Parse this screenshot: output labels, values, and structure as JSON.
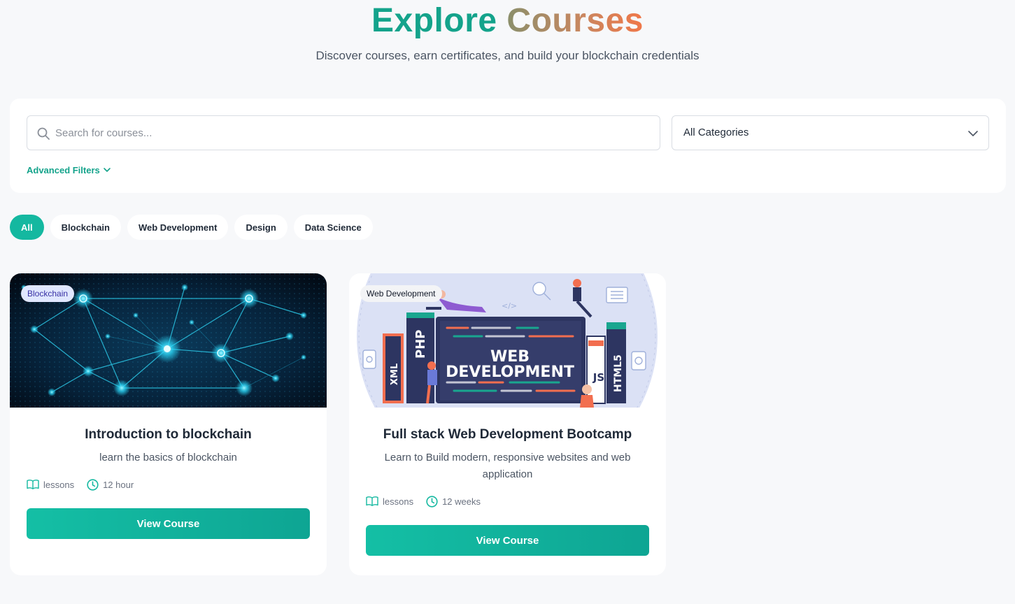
{
  "hero": {
    "title_part1": "Explore",
    "title_part2": "Courses",
    "subtitle": "Discover courses, earn certificates, and build your blockchain credentials"
  },
  "search": {
    "placeholder": "Search for courses...",
    "value": "",
    "category_selected": "All Categories",
    "category_options": [
      "All Categories"
    ],
    "advanced_filters_label": "Advanced Filters"
  },
  "filters": {
    "pills": [
      {
        "label": "All",
        "active": true
      },
      {
        "label": "Blockchain",
        "active": false
      },
      {
        "label": "Web Development",
        "active": false
      },
      {
        "label": "Design",
        "active": false
      },
      {
        "label": "Data Science",
        "active": false
      }
    ]
  },
  "courses": [
    {
      "badge": "Blockchain",
      "title": "Introduction to blockchain",
      "description": "learn the basics of blockchain",
      "lessons_label": "lessons",
      "duration": "12 hour",
      "button_label": "View Course"
    },
    {
      "badge": "Web Development",
      "title": "Full stack Web Development Bootcamp",
      "description": "Learn to Build modern, responsive websites and web application",
      "lessons_label": "lessons",
      "duration": "12 weeks",
      "button_label": "View Course",
      "image_text": {
        "line1": "WEB",
        "line2": "DEVELOPMENT",
        "book_php": "PHP",
        "book_xml": "XML",
        "book_html5": "HTML5",
        "book_js": "JS"
      }
    }
  ],
  "colors": {
    "accent": "#14b8a0",
    "accent_dark": "#0ea593",
    "title_green": "#14a38b",
    "title_orange": "#f07748",
    "background": "#f7f8fa",
    "blockchain_badge_bg": "#e0e7ff",
    "blockchain_badge_text": "#3730a3",
    "webdev_badge_bg": "#f3f4f6"
  },
  "icons": {
    "search": "search-icon",
    "chevron": "chevron-down-icon",
    "lessons": "book-open-icon",
    "duration": "clock-icon"
  }
}
